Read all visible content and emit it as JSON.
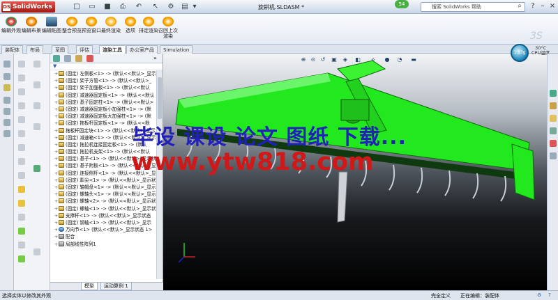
{
  "app": {
    "logo_text": "SolidWorks",
    "title": "旋耕机.SLDASM *",
    "notification_count": "54"
  },
  "search": {
    "placeholder": "搜索 SolidWorks 帮助"
  },
  "ribbon": {
    "buttons": [
      {
        "label": "编辑外观"
      },
      {
        "label": "编辑布景"
      },
      {
        "label": "编辑贴图"
      },
      {
        "label": "整合预览"
      },
      {
        "label": "预览窗口"
      },
      {
        "label": "最终渲染"
      },
      {
        "label": "选项"
      },
      {
        "label": "排定渲染"
      },
      {
        "label": "召回上次渲染"
      }
    ]
  },
  "tabs": [
    {
      "label": "装配体"
    },
    {
      "label": "布局"
    },
    {
      "label": "草图"
    },
    {
      "label": "评估"
    },
    {
      "label": "渲染工具",
      "active": true
    },
    {
      "label": "办公室产品"
    },
    {
      "label": "Simulation"
    }
  ],
  "tree": {
    "items": [
      {
        "text": "(固定) 左侧板<1> -> (默认<<默认>_显示"
      },
      {
        "text": "(固定) 架子方管<1> -> (默认<<默认>_"
      },
      {
        "text": "(固定) 架子加强板<1> -> (默认<<默认"
      },
      {
        "text": "(固定) 减速器固定板<1> -> (默认<<默认"
      },
      {
        "text": "(固定) 基子固定柱<1> -> (默认<<默认>"
      },
      {
        "text": "(固定) 减速器固定板小加强柱<1> -> (默"
      },
      {
        "text": "(固定) 减速器固定板大加强柱<1> -> (默"
      },
      {
        "text": "(固定) 拖板杆固定板<1> -> (默认<<默"
      },
      {
        "text": "拖板杆固定块<1> -> (默认<<默认>_显示"
      },
      {
        "text": "(固定) 减速箱<1> -> (默认<<默认>_显示"
      },
      {
        "text": "(固定) 拖拉机连接固定板<1> -> (默认"
      },
      {
        "text": "(固定) 拖拉机支架<1> -> (默认<<默认"
      },
      {
        "text": "(固定) 基子<1> -> (默认<<默认>_显示状态"
      },
      {
        "text": "(固定) 基子附板<1> -> (默认<<默认>_显"
      },
      {
        "text": "(固定) 连接侧杆<1> -> (默认<<默认>_显"
      },
      {
        "text": "(固定) 犁尖<1> -> (默认<<默认>_显示状"
      },
      {
        "text": "(固定) 轴帽盘<1> -> (默认<<默认>_显示"
      },
      {
        "text": "(固定) 螺轴头<1> -> (默认<<默认>_显示"
      },
      {
        "text": "(固定) 螺轴<2> -> (默认<<默认>_显示状态"
      },
      {
        "text": "(固定) 螺轴<1> -> (默认<<默认>_显示状"
      },
      {
        "text": "支撑杆<1> -> (默认<<默认>_显示状态"
      },
      {
        "text": "(固定) 钢轴<1> -> (默认<<默认>_显示"
      },
      {
        "text": "万向节<1> (默认<<默认>_显示状态 1>"
      },
      {
        "text": "配合"
      },
      {
        "text": "局部线性阵列1"
      }
    ]
  },
  "bottom_tabs": [
    {
      "label": "模型"
    },
    {
      "label": "运动算例 1"
    }
  ],
  "overlay": {
    "line1": "毕设 课设 论文 图纸 下载...",
    "line2": "www.ytw818.com"
  },
  "temperature": {
    "value": "1.93g",
    "label_top": "30°C",
    "label_bottom": "CPU温度"
  },
  "status": {
    "left": "选择实体以修改其外观",
    "center": "完全定义",
    "right": "正在编辑：装配体"
  },
  "colors": {
    "model_green": "#22e81e",
    "overlay_blue": "#2121b9",
    "overlay_red": "#d01818"
  }
}
